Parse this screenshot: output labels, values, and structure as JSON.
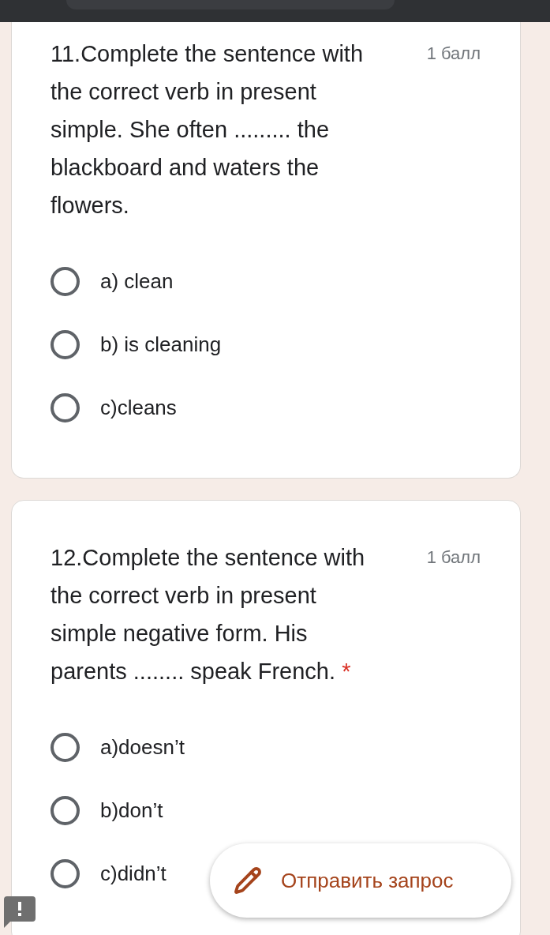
{
  "questions": [
    {
      "text": "11.Complete the sentence with the correct verb in present simple. She often ......... the blackboard and waters the flowers.",
      "points": "1 балл",
      "options": [
        {
          "label": "a) clean",
          "selected": false
        },
        {
          "label": "b) is cleaning",
          "selected": false
        },
        {
          "label": "c)cleans",
          "selected": false
        }
      ]
    },
    {
      "text": "12.Complete the sentence with the correct verb in present simple negative form. His parents ........ speak French.",
      "required_mark": "*",
      "points": "1 балл",
      "options": [
        {
          "label": "a)doesn’t",
          "selected": false
        },
        {
          "label": "b)don’t",
          "selected": false
        },
        {
          "label": "c)didn’t",
          "selected": false
        }
      ]
    }
  ],
  "submit_button": {
    "label": "Отправить запрос"
  }
}
